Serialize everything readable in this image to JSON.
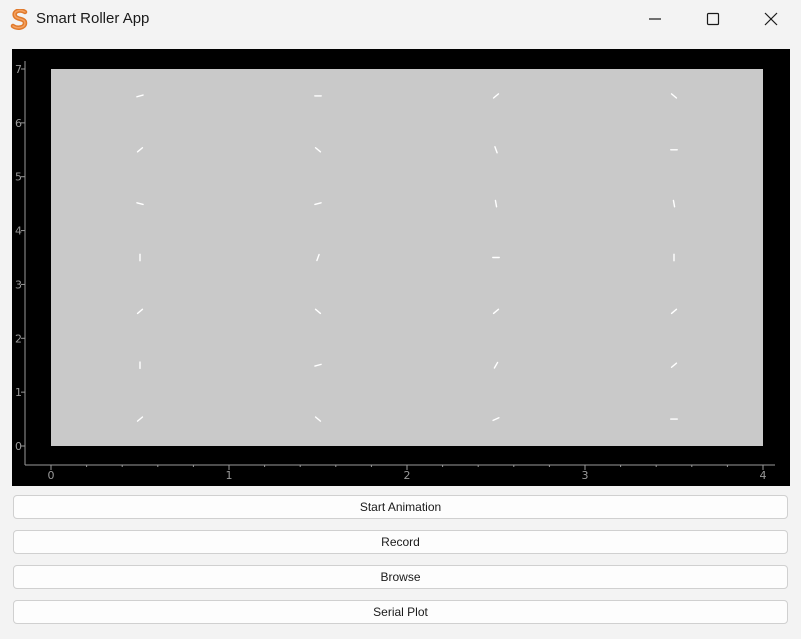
{
  "window": {
    "title": "Smart Roller App",
    "icon": "s-logo-icon",
    "controls": [
      "minimize-icon",
      "maximize-icon",
      "close-icon"
    ]
  },
  "plot": {
    "background": "#000000",
    "field_color": "#c9c9c9",
    "axis_color": "#9a9a9a",
    "x_ticks": [
      "0",
      "1",
      "2",
      "3",
      "4"
    ],
    "y_ticks": [
      "0",
      "1",
      "2",
      "3",
      "4",
      "5",
      "6",
      "7"
    ],
    "xlim": [
      0,
      4
    ],
    "ylim": [
      0,
      7
    ],
    "rollers": {
      "x": [
        0.5,
        1.5,
        2.5,
        3.5
      ],
      "y": [
        0.5,
        1.5,
        2.5,
        3.5,
        4.5,
        5.5,
        6.5
      ],
      "angles": [
        [
          40,
          -40,
          25,
          0
        ],
        [
          90,
          15,
          60,
          40
        ],
        [
          40,
          -40,
          40,
          40
        ],
        [
          90,
          70,
          0,
          90
        ],
        [
          -15,
          15,
          100,
          100
        ],
        [
          40,
          -40,
          110,
          0
        ],
        [
          15,
          0,
          40,
          -40
        ]
      ]
    }
  },
  "buttons": {
    "start": "Start Animation",
    "record": "Record",
    "browse": "Browse",
    "serial": "Serial Plot"
  }
}
